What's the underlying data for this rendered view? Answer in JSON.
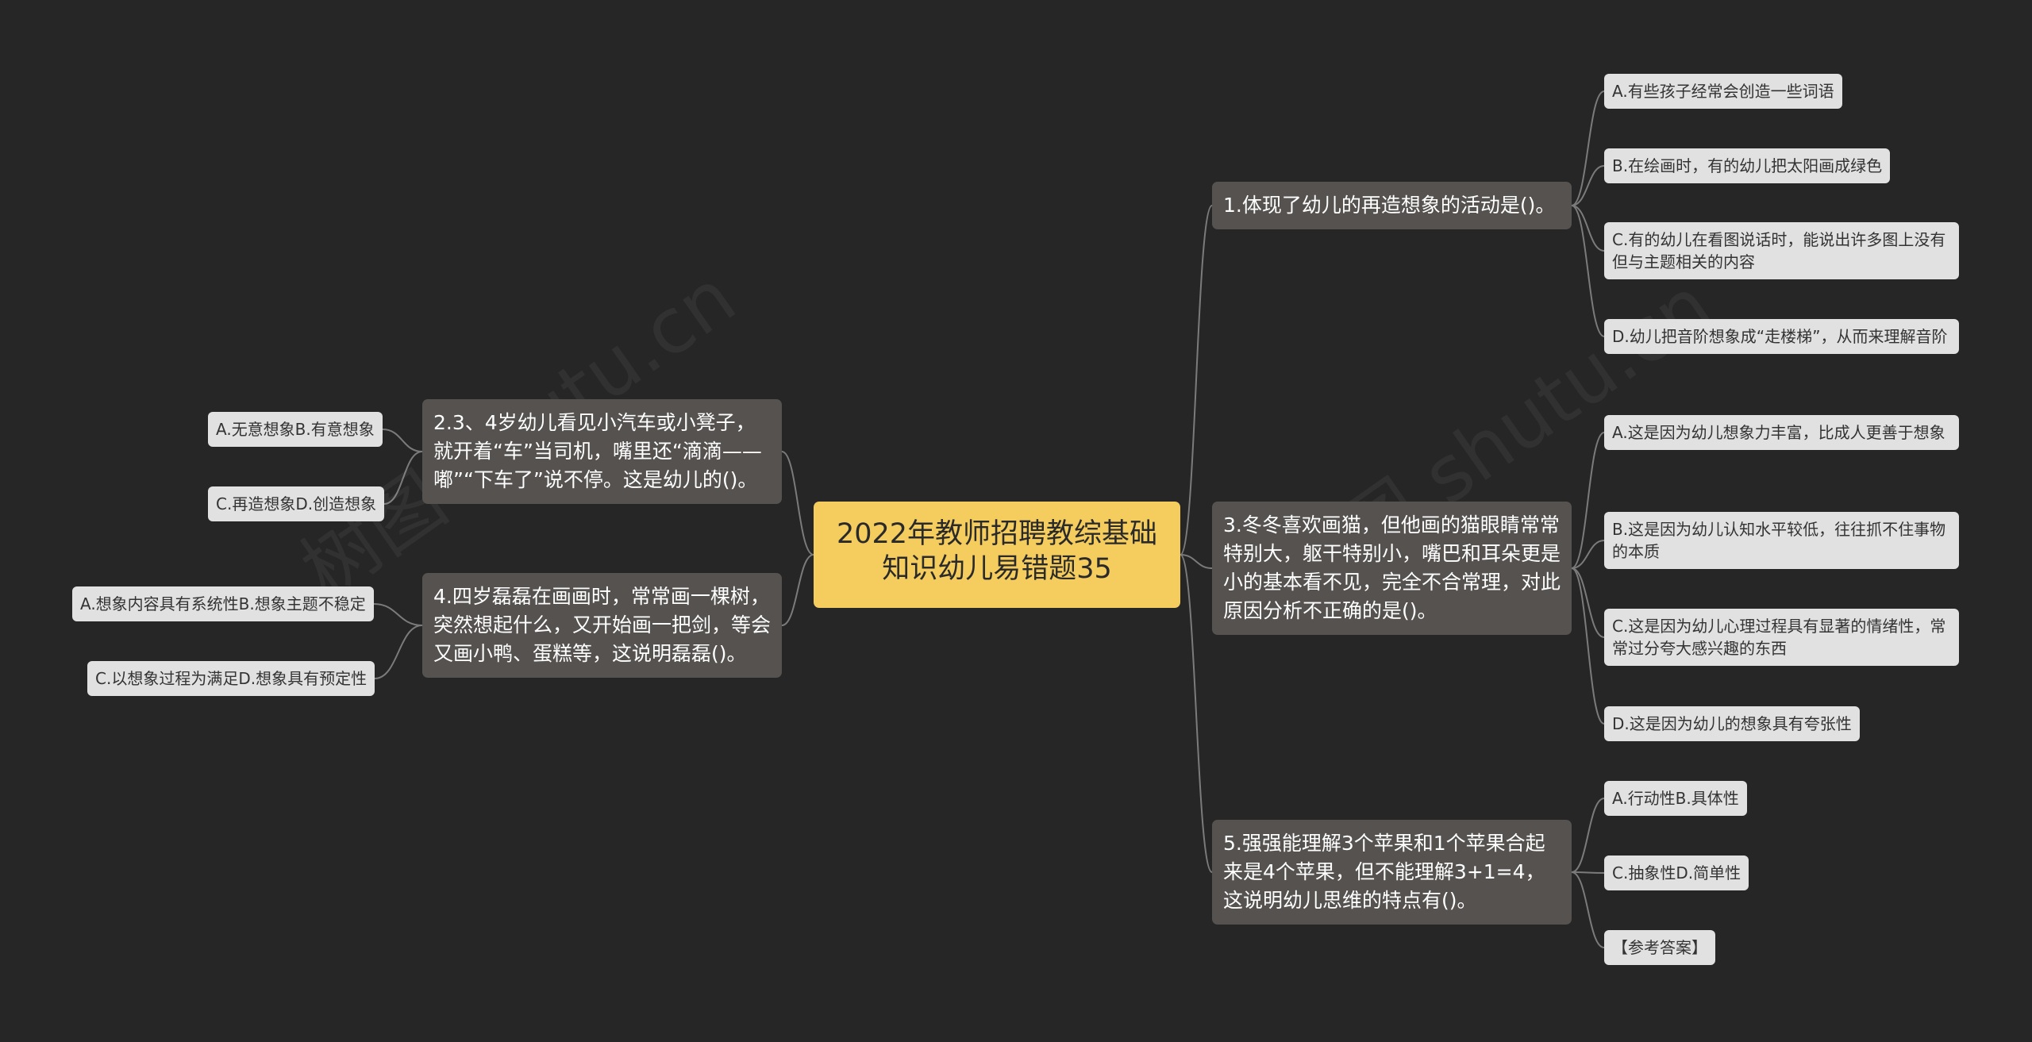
{
  "root": {
    "title": "2022年教师招聘教综基础知识幼儿易错题35"
  },
  "questions": [
    {
      "text": "1.体现了幼儿的再造想象的活动是()。",
      "options": [
        "A.有些孩子经常会创造一些词语",
        "B.在绘画时，有的幼儿把太阳画成绿色",
        "C.有的幼儿在看图说话时，能说出许多图上没有但与主题相关的内容",
        "D.幼儿把音阶想象成“走楼梯”，从而来理解音阶"
      ]
    },
    {
      "text": "2.3、4岁幼儿看见小汽车或小凳子，就开着“车”当司机，嘴里还“滴滴——嘟”“下车了”说不停。这是幼儿的()。",
      "options": [
        "A.无意想象B.有意想象",
        "C.再造想象D.创造想象"
      ]
    },
    {
      "text": "3.冬冬喜欢画猫，但他画的猫眼睛常常特别大，躯干特别小，嘴巴和耳朵更是小的基本看不见，完全不合常理，对此原因分析不正确的是()。",
      "options": [
        "A.这是因为幼儿想象力丰富，比成人更善于想象",
        "B.这是因为幼儿认知水平较低，往往抓不住事物的本质",
        "C.这是因为幼儿心理过程具有显著的情绪性，常常过分夸大感兴趣的东西",
        "D.这是因为幼儿的想象具有夸张性"
      ]
    },
    {
      "text": "4.四岁磊磊在画画时，常常画一棵树，突然想起什么，又开始画一把剑，等会又画小鸭、蛋糕等，这说明磊磊()。",
      "options": [
        "A.想象内容具有系统性B.想象主题不稳定",
        "C.以想象过程为满足D.想象具有预定性"
      ]
    },
    {
      "text": "5.强强能理解3个苹果和1个苹果合起来是4个苹果，但不能理解3+1=4，这说明幼儿思维的特点有()。",
      "options": [
        "A.行动性B.具体性",
        "C.抽象性D.简单性",
        "【参考答案】"
      ]
    }
  ],
  "watermarks": [
    "树图 shutu.cn",
    "树图 shutu.cn"
  ],
  "colors": {
    "background": "#262626",
    "root": "#f5cd5e",
    "question": "#555250",
    "option": "#e1e1e1",
    "line": "#7b7b7b"
  }
}
